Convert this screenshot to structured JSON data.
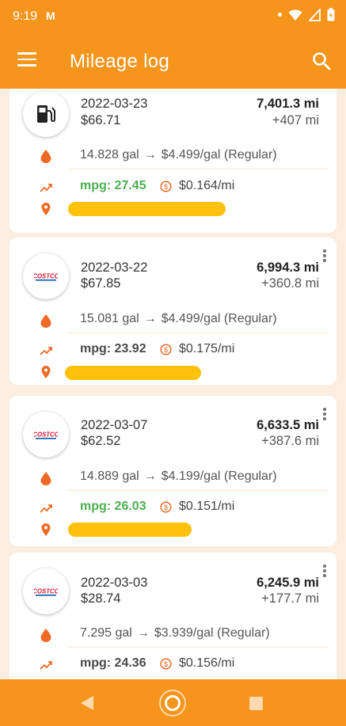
{
  "status_bar": {
    "time": "9:19",
    "mail_glyph": "M"
  },
  "app_bar": {
    "title": "Mileage log"
  },
  "colors": {
    "primary": "#f6951c",
    "accent_icon": "#ef6b25",
    "mpg_green": "#4caf50",
    "redaction": "#fdc10e"
  },
  "entries": [
    {
      "date": "2022-03-23",
      "cost": "$66.71",
      "odometer": "7,401.3 mi",
      "distance": "+407 mi",
      "gallons": "14.828 gal",
      "arrow": "→",
      "price": "$4.499/gal (Regular)",
      "mpg": "mpg: 27.45",
      "mpg_highlight": true,
      "cost_per_mile": "$0.164/mi",
      "station_icon": "fuel-pump-icon"
    },
    {
      "date": "2022-03-22",
      "cost": "$67.85",
      "odometer": "6,994.3 mi",
      "distance": "+360.8 mi",
      "gallons": "15.081 gal",
      "arrow": "→",
      "price": "$4.499/gal (Regular)",
      "mpg": "mpg: 23.92",
      "mpg_highlight": false,
      "cost_per_mile": "$0.175/mi",
      "station_icon": "costco-logo",
      "logo_text": "COSTCO"
    },
    {
      "date": "2022-03-07",
      "cost": "$62.52",
      "odometer": "6,633.5 mi",
      "distance": "+387.6 mi",
      "gallons": "14.889 gal",
      "arrow": "→",
      "price": "$4.199/gal (Regular)",
      "mpg": "mpg: 26.03",
      "mpg_highlight": true,
      "cost_per_mile": "$0.151/mi",
      "station_icon": "costco-logo",
      "logo_text": "COSTCO"
    },
    {
      "date": "2022-03-03",
      "cost": "$28.74",
      "odometer": "6,245.9 mi",
      "distance": "+177.7 mi",
      "gallons": "7.295 gal",
      "arrow": "→",
      "price": "$3.939/gal (Regular)",
      "mpg": "mpg: 24.36",
      "mpg_highlight": false,
      "cost_per_mile": "$0.156/mi",
      "station_icon": "costco-logo",
      "logo_text": "COSTCO"
    }
  ]
}
